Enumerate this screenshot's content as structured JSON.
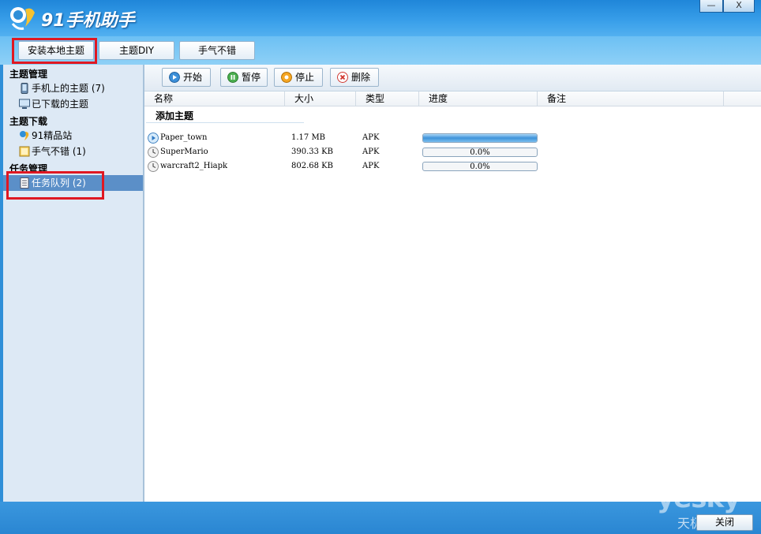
{
  "app": {
    "title": "91手机助手",
    "minimize_label": "—",
    "close_label": "X"
  },
  "top_tabs": [
    {
      "label": "安装本地主题"
    },
    {
      "label": "主题DIY"
    },
    {
      "label": "手气不错"
    }
  ],
  "sidebar": {
    "sections": [
      {
        "title": "主题管理"
      },
      {
        "title": "主题下载"
      },
      {
        "title": "任务管理"
      }
    ],
    "items": [
      {
        "label": "手机上的主题 (7)",
        "icon": "phone-icon"
      },
      {
        "label": "已下载的主题",
        "icon": "monitor-icon"
      },
      {
        "label": "91精品站",
        "icon": "91-logo-icon"
      },
      {
        "label": "手气不错 (1)",
        "icon": "folder-icon"
      },
      {
        "label": "任务队列 (2)",
        "icon": "document-icon",
        "selected": true
      }
    ]
  },
  "toolbar": {
    "start_label": "开始",
    "pause_label": "暂停",
    "stop_label": "停止",
    "delete_label": "删除"
  },
  "table": {
    "headers": [
      "名称",
      "大小",
      "类型",
      "进度",
      "备注"
    ],
    "group_title": "添加主题",
    "rows": [
      {
        "name": "Paper_town",
        "size": "1.17 MB",
        "type": "APK",
        "progress": 1.0,
        "progress_text": "",
        "status_icon": "play-icon"
      },
      {
        "name": "SuperMario",
        "size": "390.33 KB",
        "type": "APK",
        "progress": 0.0,
        "progress_text": "0.0%",
        "status_icon": "clock-icon"
      },
      {
        "name": "warcraft2_Hiapk",
        "size": "802.68 KB",
        "type": "APK",
        "progress": 0.0,
        "progress_text": "0.0%",
        "status_icon": "clock-icon"
      }
    ]
  },
  "footer": {
    "close_label": "关闭"
  },
  "watermark": {
    "brand": "yesky",
    "sub": "天极网"
  },
  "colors": {
    "accent_blue": "#2f8fd8",
    "selected_row": "#5b8fc8",
    "highlight_red": "#e01822",
    "progress_fill": "#3e92d9"
  }
}
